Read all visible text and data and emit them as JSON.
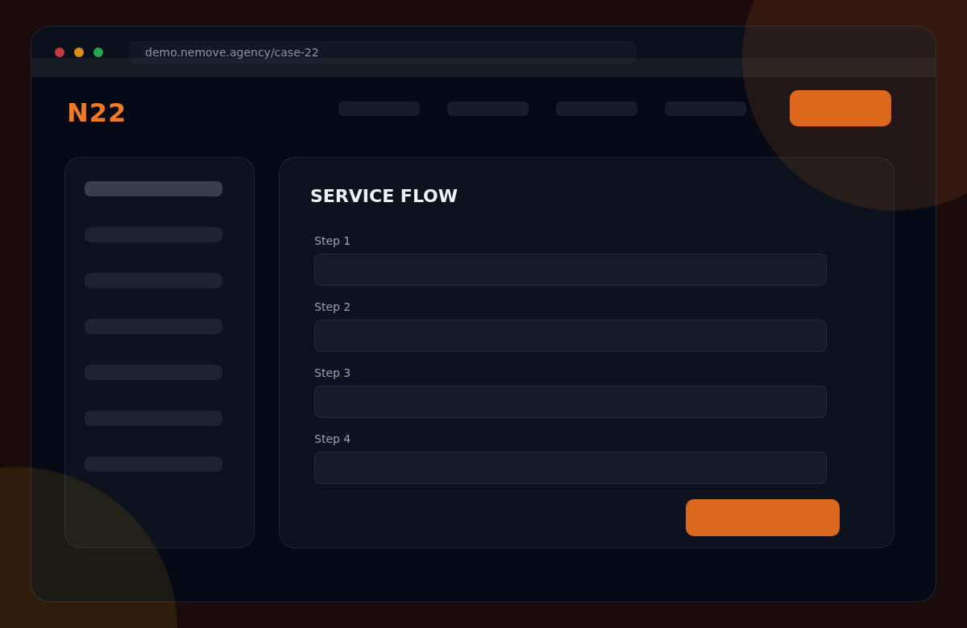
{
  "window": {
    "url": "demo.nemove.agency/case-22"
  },
  "header": {
    "logo": "N22",
    "nav_links": [
      {
        "kind": "skeleton"
      },
      {
        "kind": "skeleton"
      },
      {
        "kind": "skeleton"
      },
      {
        "kind": "skeleton"
      }
    ],
    "cta_button": {
      "kind": "filled"
    }
  },
  "sidebar": {
    "items": [
      {
        "selected": true
      },
      {
        "selected": false
      },
      {
        "selected": false
      },
      {
        "selected": false
      },
      {
        "selected": false
      },
      {
        "selected": false
      },
      {
        "selected": false
      }
    ]
  },
  "form": {
    "title": "SERVICE FLOW",
    "fields": [
      {
        "label": "Step 1"
      },
      {
        "label": "Step 2"
      },
      {
        "label": "Step 3"
      },
      {
        "label": "Step 4"
      }
    ],
    "submit_button": {
      "kind": "filled"
    }
  }
}
